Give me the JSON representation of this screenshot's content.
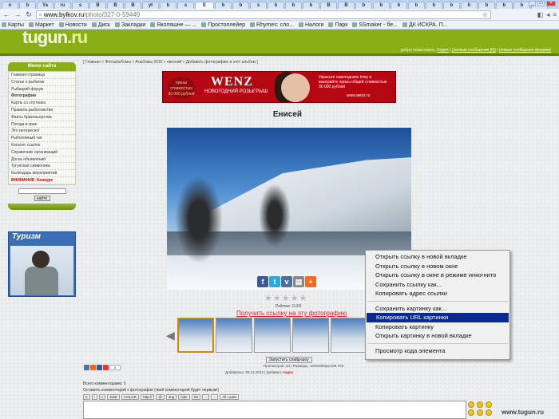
{
  "browser": {
    "tabs": [
      "n",
      "b",
      "Ya",
      "ru",
      "s",
      "B",
      "B",
      "B",
      "yt",
      "b",
      "s",
      "b",
      "b",
      "s",
      "b",
      "b",
      "b",
      "B",
      "B",
      "b",
      "b",
      "b",
      "b",
      "b",
      "b",
      "b",
      "b",
      "b",
      "b",
      "b"
    ],
    "active_tab": "Е",
    "url_host": "www.bylkov.ru",
    "url_path": "/photo/327-0-59449",
    "bookmarks": [
      "Карты",
      "Маркет",
      "Новости",
      "Диск",
      "Закладки",
      "Яколяшне — ...",
      "Простоплейер",
      "Rhymes: сло...",
      "Налоги",
      "Парк",
      "SSmaker - бе...",
      "ДК ИСКРА. П..."
    ]
  },
  "site": {
    "logo_main": "tugun",
    "logo_tld": ".ru",
    "header_welcome": "добро пожаловать,",
    "header_links": [
      "Evgen",
      "(личные сообщения [0])",
      "(новые сообщения форума)"
    ]
  },
  "sidebar": {
    "heading": "Меню сайта",
    "items": [
      {
        "label": "Главная страница"
      },
      {
        "label": "Статьи о рыбалке"
      },
      {
        "label": "Рыбацкий форум"
      },
      {
        "label": "Фотографии"
      },
      {
        "label": "Карты со спутника"
      },
      {
        "label": "Правила рыболовства"
      },
      {
        "label": "Факты браконьерства"
      },
      {
        "label": "Погода в крае"
      },
      {
        "label": "Это интересно!"
      },
      {
        "label": "Рыболовный чат"
      },
      {
        "label": "Каталог ссылок"
      },
      {
        "label": "Справочник организаций"
      },
      {
        "label": "Доска объявлений"
      },
      {
        "label": "Тугунская символика"
      },
      {
        "label": "Календарь мероприятий"
      },
      {
        "label": "ВНИМАНИЕ: Конкурс"
      }
    ],
    "search_button": "найти",
    "tourism_title": "Туризм"
  },
  "main": {
    "breadcrumb": "[ Главная » Фотоальбомы » Альбомы 2010 » евгений » Добавить фотографию в этот альбом ]",
    "banner": {
      "title": "WENZ",
      "subtitle": "НОВОГОДНИЙ РОЗЫГРЫШ",
      "text": "Украсьте новогоднюю ёлку и выиграйте призы общей стоимостью 30 000 рублей",
      "url": "www.wenz.ru",
      "badge": "призы стоимостью 30 000 рублей"
    },
    "photo_title": "Енисей",
    "rating": "Рейтинг: 0.0/0",
    "get_link": "Получить ссылку на эту фотографию",
    "slideshow": "Запустить слайд-шоу",
    "counter": "0",
    "stats_line1": "Просмотров: 34 | Размеры: 1200x800px/109.7Kb",
    "stats_line2": "Добавлено: 09.12.2012 | Добавил: ",
    "comments_count": "Всего комментариев: 0",
    "leave_comment": "Оставить комментарий к фотографии (твой комментарий будет первым!)",
    "editor_buttons": [
      "b",
      "i",
      "u",
      "SIZE",
      "COLOR",
      "http://",
      "@",
      "img",
      "hide",
      "list",
      "--",
      "--",
      "All codes"
    ],
    "watermark": "www.tugun.ru"
  },
  "context_menu": {
    "group1": [
      "Открыть ссылку в новой вкладке",
      "Открыть ссылку в новом окне",
      "Открыть ссылку в окне в режиме инкогнито",
      "Сохранить ссылку как...",
      "Копировать адрес ссылки"
    ],
    "group2": [
      "Сохранить картинку как...",
      "Копировать URL картинки",
      "Копировать картинку",
      "Открыть картинку в новой вкладке"
    ],
    "group3": [
      "Просмотр кода элемента"
    ],
    "highlighted": "Копировать URL картинки"
  }
}
